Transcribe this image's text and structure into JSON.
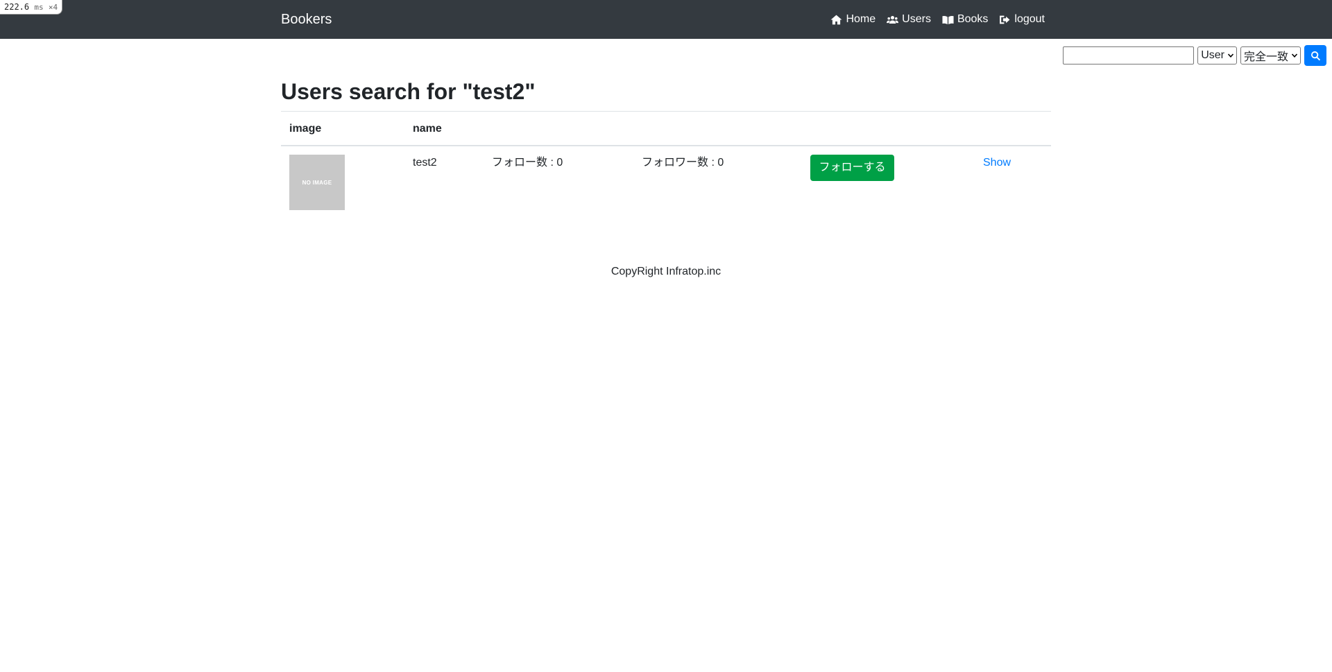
{
  "perf": {
    "value": "222.6",
    "unit": "ms",
    "multiplier": "×4"
  },
  "navbar": {
    "brand": "Bookers",
    "links": [
      {
        "label": "Home",
        "icon": "home-icon"
      },
      {
        "label": "Users",
        "icon": "users-icon"
      },
      {
        "label": "Books",
        "icon": "book-icon"
      },
      {
        "label": "logout",
        "icon": "sign-out-icon"
      }
    ]
  },
  "search": {
    "value": "",
    "placeholder": "",
    "model_select": "User",
    "method_select": "完全一致",
    "button_icon": "search-icon"
  },
  "main": {
    "title": "Users search for \"test2\"",
    "table": {
      "headers": [
        "image",
        "name"
      ],
      "rows": [
        {
          "image_text": "NO IMAGE",
          "name": "test2",
          "follow_count": "フォロー数 : 0",
          "follower_count": "フォロワー数 : 0",
          "follow_button": "フォローする",
          "show_link": "Show"
        }
      ]
    }
  },
  "footer": {
    "text": "CopyRight Infratop.inc"
  },
  "colors": {
    "navbar": "#343a40",
    "primary": "#007bff",
    "follow": "#00a046",
    "noimage": "#c8c8c8"
  }
}
